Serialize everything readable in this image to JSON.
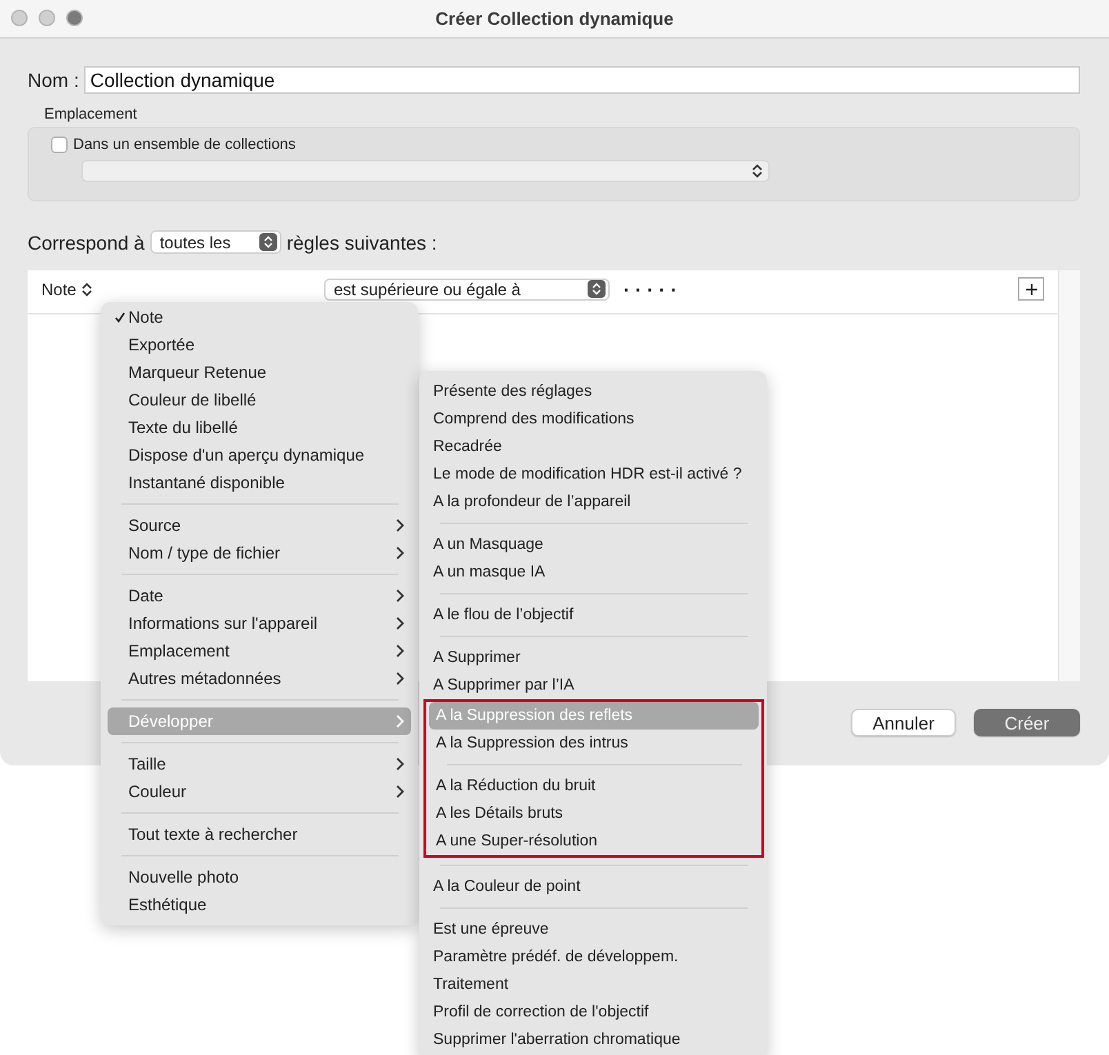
{
  "window": {
    "title": "Créer Collection dynamique"
  },
  "name_field": {
    "label": "Nom :",
    "value": "Collection dynamique"
  },
  "location": {
    "label": "Emplacement",
    "checkbox": {
      "label": "Dans un ensemble de collections",
      "checked": false
    }
  },
  "match": {
    "prefix": "Correspond à",
    "value": "toutes les",
    "suffix": "règles suivantes :"
  },
  "rule": {
    "field": "Note",
    "operator": "est supérieure ou égale à",
    "rating": "· · · · ·"
  },
  "buttons": [
    {
      "label": "Annuler",
      "kind": "secondary"
    },
    {
      "label": "Créer",
      "kind": "primary"
    }
  ],
  "field_menu": {
    "sections": [
      [
        {
          "label": "Note",
          "checked": true,
          "submenu": false,
          "selected": false
        },
        {
          "label": "Exportée",
          "checked": false,
          "submenu": false,
          "selected": false
        },
        {
          "label": "Marqueur Retenue",
          "checked": false,
          "submenu": false,
          "selected": false
        },
        {
          "label": "Couleur de libellé",
          "checked": false,
          "submenu": false,
          "selected": false
        },
        {
          "label": "Texte du libellé",
          "checked": false,
          "submenu": false,
          "selected": false
        },
        {
          "label": "Dispose d'un aperçu dynamique",
          "checked": false,
          "submenu": false,
          "selected": false
        },
        {
          "label": "Instantané disponible",
          "checked": false,
          "submenu": false,
          "selected": false
        }
      ],
      [
        {
          "label": "Source",
          "checked": false,
          "submenu": true,
          "selected": false
        },
        {
          "label": "Nom / type de fichier",
          "checked": false,
          "submenu": true,
          "selected": false
        }
      ],
      [
        {
          "label": "Date",
          "checked": false,
          "submenu": true,
          "selected": false
        },
        {
          "label": "Informations sur l'appareil",
          "checked": false,
          "submenu": true,
          "selected": false
        },
        {
          "label": "Emplacement",
          "checked": false,
          "submenu": true,
          "selected": false
        },
        {
          "label": "Autres métadonnées",
          "checked": false,
          "submenu": true,
          "selected": false
        }
      ],
      [
        {
          "label": "Développer",
          "checked": false,
          "submenu": true,
          "selected": true
        }
      ],
      [
        {
          "label": "Taille",
          "checked": false,
          "submenu": true,
          "selected": false
        },
        {
          "label": "Couleur",
          "checked": false,
          "submenu": true,
          "selected": false
        }
      ],
      [
        {
          "label": "Tout texte à rechercher",
          "checked": false,
          "submenu": false,
          "selected": false
        }
      ],
      [
        {
          "label": "Nouvelle photo",
          "checked": false,
          "submenu": false,
          "selected": false
        },
        {
          "label": "Esthétique",
          "checked": false,
          "submenu": false,
          "selected": false
        }
      ]
    ]
  },
  "develop_submenu": {
    "sections": [
      [
        {
          "label": "Présente des réglages",
          "selected": false,
          "framed": false
        },
        {
          "label": "Comprend des modifications",
          "selected": false,
          "framed": false
        },
        {
          "label": "Recadrée",
          "selected": false,
          "framed": false
        },
        {
          "label": "Le mode de modification HDR est-il activé ?",
          "selected": false,
          "framed": false
        },
        {
          "label": "A la profondeur de l’appareil",
          "selected": false,
          "framed": false
        }
      ],
      [
        {
          "label": "A un Masquage",
          "selected": false,
          "framed": false
        },
        {
          "label": "A un masque IA",
          "selected": false,
          "framed": false
        }
      ],
      [
        {
          "label": "A le flou de l’objectif",
          "selected": false,
          "framed": false
        }
      ],
      [
        {
          "label": "A Supprimer",
          "selected": false,
          "framed": false
        },
        {
          "label": "A Supprimer par l’IA",
          "selected": false,
          "framed": false
        },
        {
          "label": "A la Suppression des reflets",
          "selected": true,
          "framed": true
        },
        {
          "label": "A la Suppression des intrus",
          "selected": false,
          "framed": true
        }
      ],
      [
        {
          "label": "A la Réduction du bruit",
          "selected": false,
          "framed": true
        },
        {
          "label": "A les Détails bruts",
          "selected": false,
          "framed": true
        },
        {
          "label": "A une Super-résolution",
          "selected": false,
          "framed": true
        }
      ],
      [
        {
          "label": "A la Couleur de point",
          "selected": false,
          "framed": false
        }
      ],
      [
        {
          "label": "Est une épreuve",
          "selected": false,
          "framed": false
        },
        {
          "label": "Paramètre prédéf. de développem.",
          "selected": false,
          "framed": false
        },
        {
          "label": "Traitement",
          "selected": false,
          "framed": false
        },
        {
          "label": "Profil de correction de l'objectif",
          "selected": false,
          "framed": false
        },
        {
          "label": "Supprimer l'aberration chromatique",
          "selected": false,
          "framed": false
        }
      ]
    ]
  }
}
